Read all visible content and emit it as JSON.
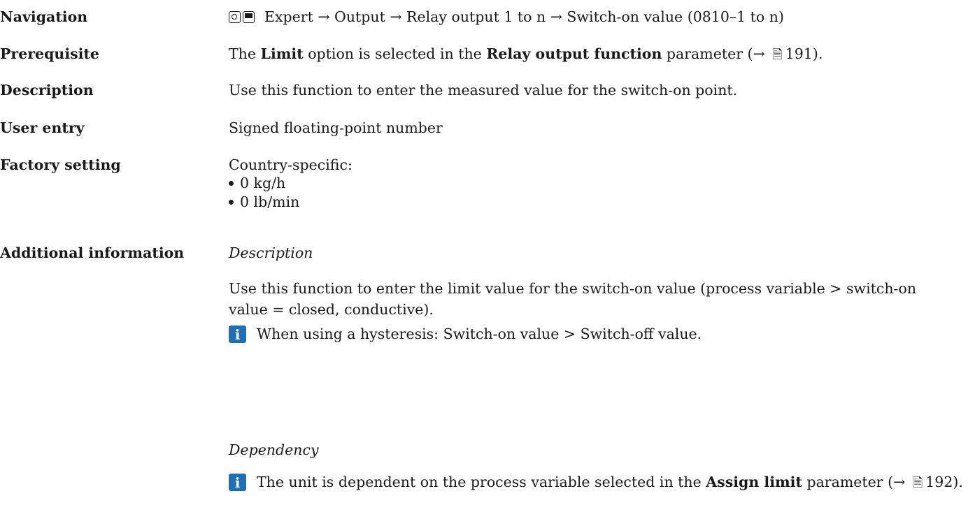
{
  "navigation": {
    "label": "Navigation",
    "path": "Expert → Output → Relay output 1 to n → Switch-on value (0810–1 to n)"
  },
  "prerequisite": {
    "label": "Prerequisite",
    "t1": "The ",
    "b1": "Limit",
    "t2": " option is selected in the ",
    "b2": "Relay output function",
    "t3": " parameter (→ ",
    "t4": "191)."
  },
  "description": {
    "label": "Description",
    "text": "Use this function to enter the measured value for the switch-on point."
  },
  "user_entry": {
    "label": "User entry",
    "text": "Signed floating-point number"
  },
  "factory_setting": {
    "label": "Factory setting",
    "intro": "Country-specific:",
    "items": [
      "0 kg/h",
      "0 lb/min"
    ]
  },
  "additional_information": {
    "label": "Additional information",
    "heading1": "Description",
    "para1": "Use this function to enter the limit value for the switch-on value (process variable > switch-on value = closed, conductive).",
    "note1": "When using a hysteresis: Switch-on value > Switch-off value.",
    "heading2": "Dependency",
    "note2_t1": "The unit is dependent on the process variable selected in the ",
    "note2_b1": "Assign limit",
    "note2_t2": " parameter (→ ",
    "note2_t3": "192)."
  },
  "icons": {
    "nav": [
      "keypad-icon",
      "display-icon"
    ],
    "page_ref": "book-icon",
    "info": "info-icon"
  },
  "colors": {
    "info_icon_bg": "#1f6fb6"
  }
}
